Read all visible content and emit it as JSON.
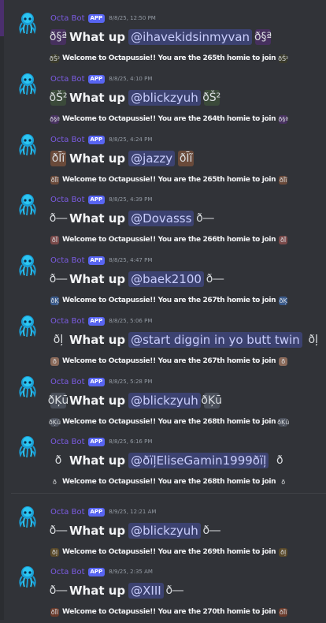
{
  "bot_name": "Octa Bot",
  "app_badge": "APP",
  "messages": [
    {
      "timestamp": "8/8/25, 12:50 PM",
      "greeting": "What up",
      "mention": "@ihavekidsinmyvan",
      "emoji": "ð§ª",
      "welcome": "Welcome to Octapussie!! You are the 265th homie to join",
      "small_emoji": "ðŠ²",
      "emoji_bg": "#46305e",
      "small_bg": "#3a3a2a"
    },
    {
      "timestamp": "8/8/25, 4:10 PM",
      "greeting": "What up",
      "mention": "@blickzyuh",
      "emoji": "ðŠ²",
      "welcome": "Welcome to Octapussie!! You are the 264th homie to join",
      "small_emoji": "ð§ª",
      "emoji_bg": "#3b4a3a",
      "small_bg": "#46305e"
    },
    {
      "timestamp": "8/8/25, 4:24 PM",
      "greeting": "What up",
      "mention": "@jazzy",
      "emoji": "ðĪĩ",
      "welcome": "Welcome to Octapussie!! You are the 265th homie to join",
      "small_emoji": "ðĪĩ",
      "emoji_bg": "#6a4a3a",
      "small_bg": "#6a4a3a"
    },
    {
      "timestamp": "8/8/25, 4:39 PM",
      "greeting": "What up",
      "mention": "@Dovasss",
      "emoji": "ð―",
      "welcome": "Welcome to Octapussie!! You are the 266th homie to join",
      "small_emoji": "ðĪ",
      "emoji_bg": "transparent",
      "small_bg": "#7a4a4a"
    },
    {
      "timestamp": "8/8/25, 4:47 PM",
      "greeting": "What up",
      "mention": "@baek2100",
      "emoji": "ð―",
      "welcome": "Welcome to Octapussie!! You are the 267th homie to join",
      "small_emoji": "ðĶ",
      "emoji_bg": "transparent",
      "small_bg": "#3a5a8a"
    },
    {
      "timestamp": "8/8/25, 5:06 PM",
      "greeting": "What up",
      "mention": "@start diggin in yo butt twin",
      "emoji": "ðļ",
      "welcome": "Welcome to Octapussie!! You are the 267th homie to join",
      "small_emoji": "ð",
      "emoji_bg": "transparent",
      "small_bg": "#8a6a5a"
    },
    {
      "timestamp": "8/8/25, 5:28 PM",
      "greeting": "What up",
      "mention": "@blickzyuh",
      "emoji": "ðĶū",
      "welcome": "Welcome to Octapussie!! You are the 268th homie to join",
      "small_emoji": "ðĶū",
      "emoji_bg": "#4a4f5a",
      "small_bg": "#4a4f5a"
    },
    {
      "timestamp": "8/8/25, 6:16 PM",
      "greeting": "What up",
      "mention": "@ðïļEliseGamin1999ðïļ",
      "emoji": "ð",
      "welcome": "Welcome to Octapussie!! You are the 268th homie to join",
      "small_emoji": "ð",
      "emoji_bg": "transparent",
      "small_bg": "transparent"
    },
    {
      "timestamp": "8/9/25, 12:21 AM",
      "greeting": "What up",
      "mention": "@blickzyuh",
      "emoji": "ð―",
      "welcome": "Welcome to Octapussie!! You are the 269th homie to join",
      "small_emoji": "ðļ",
      "emoji_bg": "transparent",
      "small_bg": "#5a4a2a"
    },
    {
      "timestamp": "8/9/25, 2:35 AM",
      "greeting": "What up",
      "mention": "@XIII",
      "emoji": "ð―",
      "welcome": "Welcome to Octapussie!! You are the 270th homie to join",
      "small_emoji": "ðĪĩ",
      "emoji_bg": "transparent",
      "small_bg": "#6a3a2a"
    }
  ]
}
